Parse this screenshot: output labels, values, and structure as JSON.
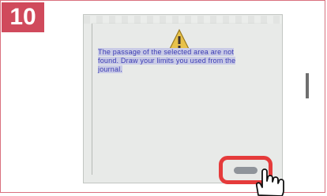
{
  "step": {
    "number": "10"
  },
  "dialog": {
    "icon": "warning-icon",
    "message": "The passage of the selected area are not found. Draw your limits you used from the journal.",
    "ok_button_label": ""
  },
  "cursor": {
    "icon": "hand-pointer-icon"
  },
  "colors": {
    "badge": "#d04a5c",
    "highlight_ring": "#e53b3b",
    "message_text": "#3b3bb3",
    "dialog_bg": "#e8eae8"
  }
}
